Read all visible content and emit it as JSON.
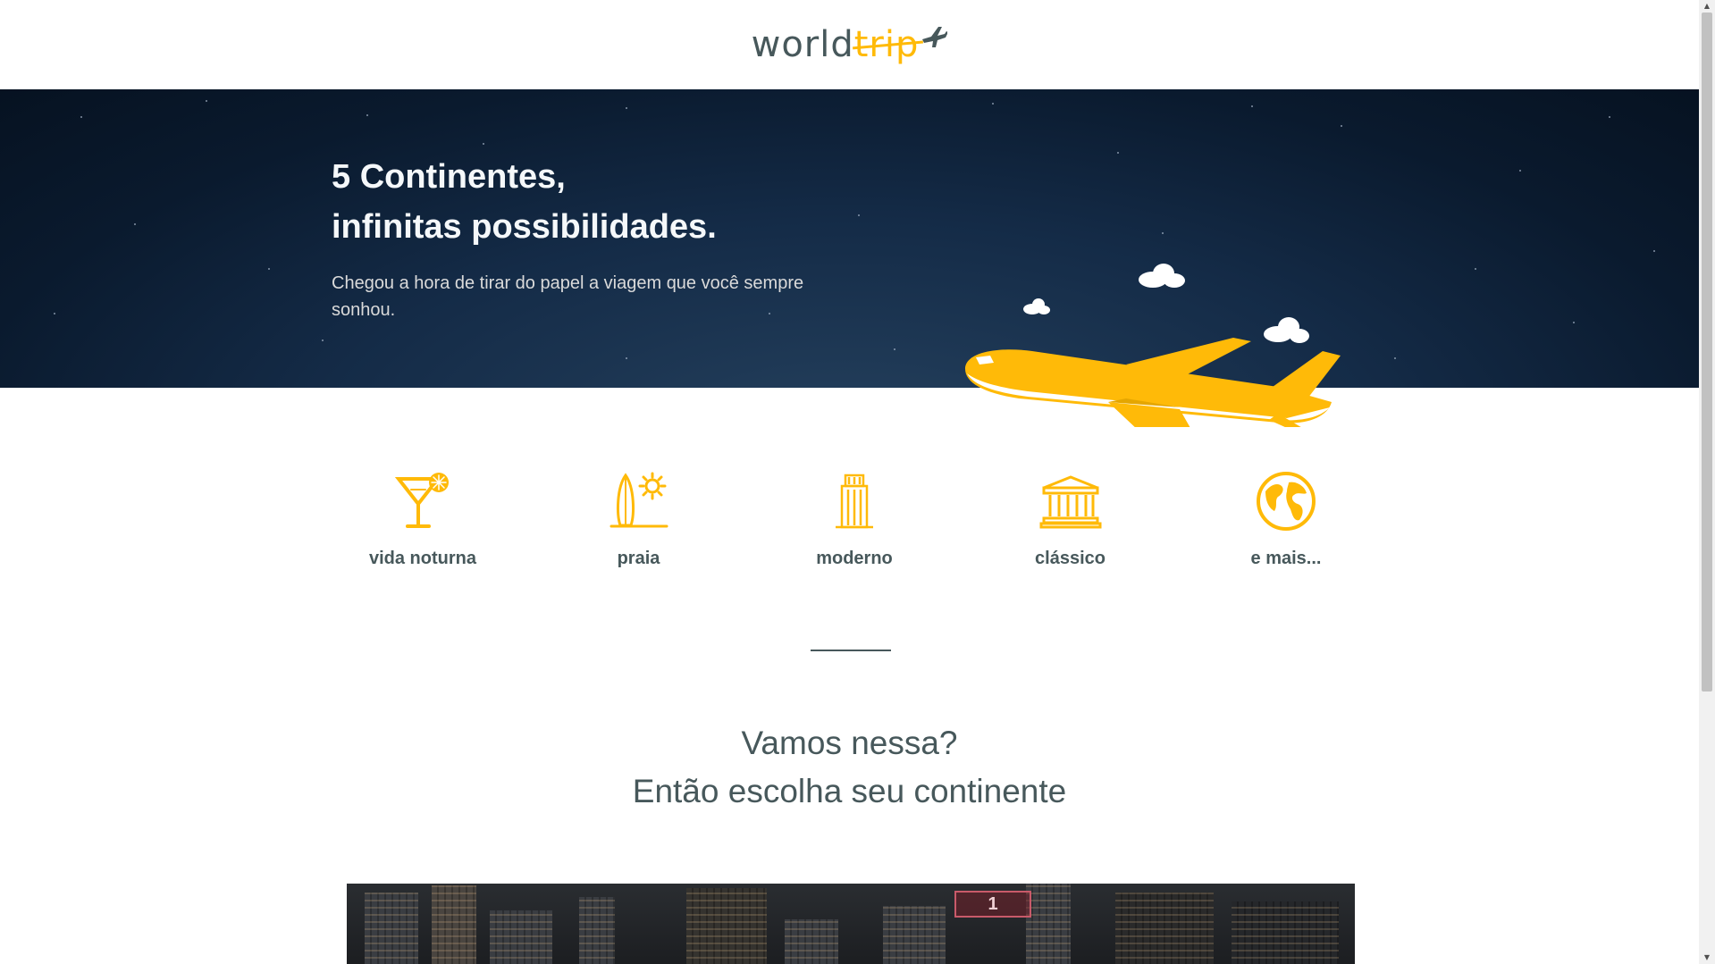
{
  "header": {
    "logo_world": "world",
    "logo_trip": "trip"
  },
  "banner": {
    "title_line1": "5 Continentes,",
    "title_line2": "infinitas possibilidades.",
    "subtitle": "Chegou a hora de tirar do papel a viagem que você sempre sonhou."
  },
  "travel_types": [
    {
      "label": "vida noturna",
      "icon": "cocktail-icon"
    },
    {
      "label": "praia",
      "icon": "surfboard-sun-icon"
    },
    {
      "label": "moderno",
      "icon": "skyscraper-icon"
    },
    {
      "label": "clássico",
      "icon": "museum-icon"
    },
    {
      "label": "e mais...",
      "icon": "globe-icon"
    }
  ],
  "cta": {
    "line1": "Vamos nessa?",
    "line2": "Então escolha seu continente"
  },
  "slider": {
    "sign_text": "1"
  },
  "colors": {
    "accent": "#FFBA08",
    "text_dark": "#47585B",
    "banner_dark": "#0a1a2e"
  }
}
